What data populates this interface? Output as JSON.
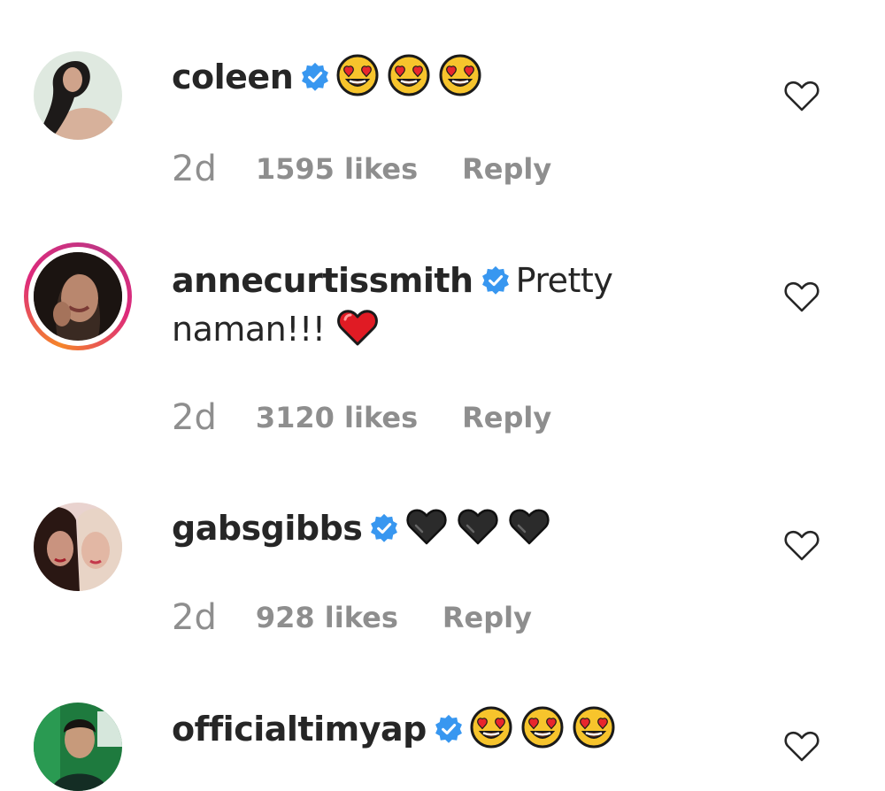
{
  "comments": [
    {
      "username": "coleen",
      "verified": true,
      "text": "",
      "emojis": [
        "heart-eyes",
        "heart-eyes",
        "heart-eyes"
      ],
      "time": "2d",
      "likes": "1595 likes",
      "reply_label": "Reply"
    },
    {
      "username": "annecurtissmith",
      "verified": true,
      "text": "Pretty naman!!!",
      "emojis": [
        "red-heart"
      ],
      "time": "2d",
      "likes": "3120 likes",
      "reply_label": "Reply",
      "has_story_ring": true
    },
    {
      "username": "gabsgibbs",
      "verified": true,
      "text": "",
      "emojis": [
        "black-heart",
        "black-heart",
        "black-heart"
      ],
      "time": "2d",
      "likes": "928 likes",
      "reply_label": "Reply"
    },
    {
      "username": "officialtimyap",
      "verified": true,
      "text": "",
      "emojis": [
        "heart-eyes",
        "heart-eyes",
        "heart-eyes"
      ]
    }
  ],
  "colors": {
    "verified": "#3897f0",
    "meta_text": "#8e8e8e",
    "username": "#262626",
    "story_ring_start": "#f58529",
    "story_ring_end": "#dd2a7b"
  }
}
